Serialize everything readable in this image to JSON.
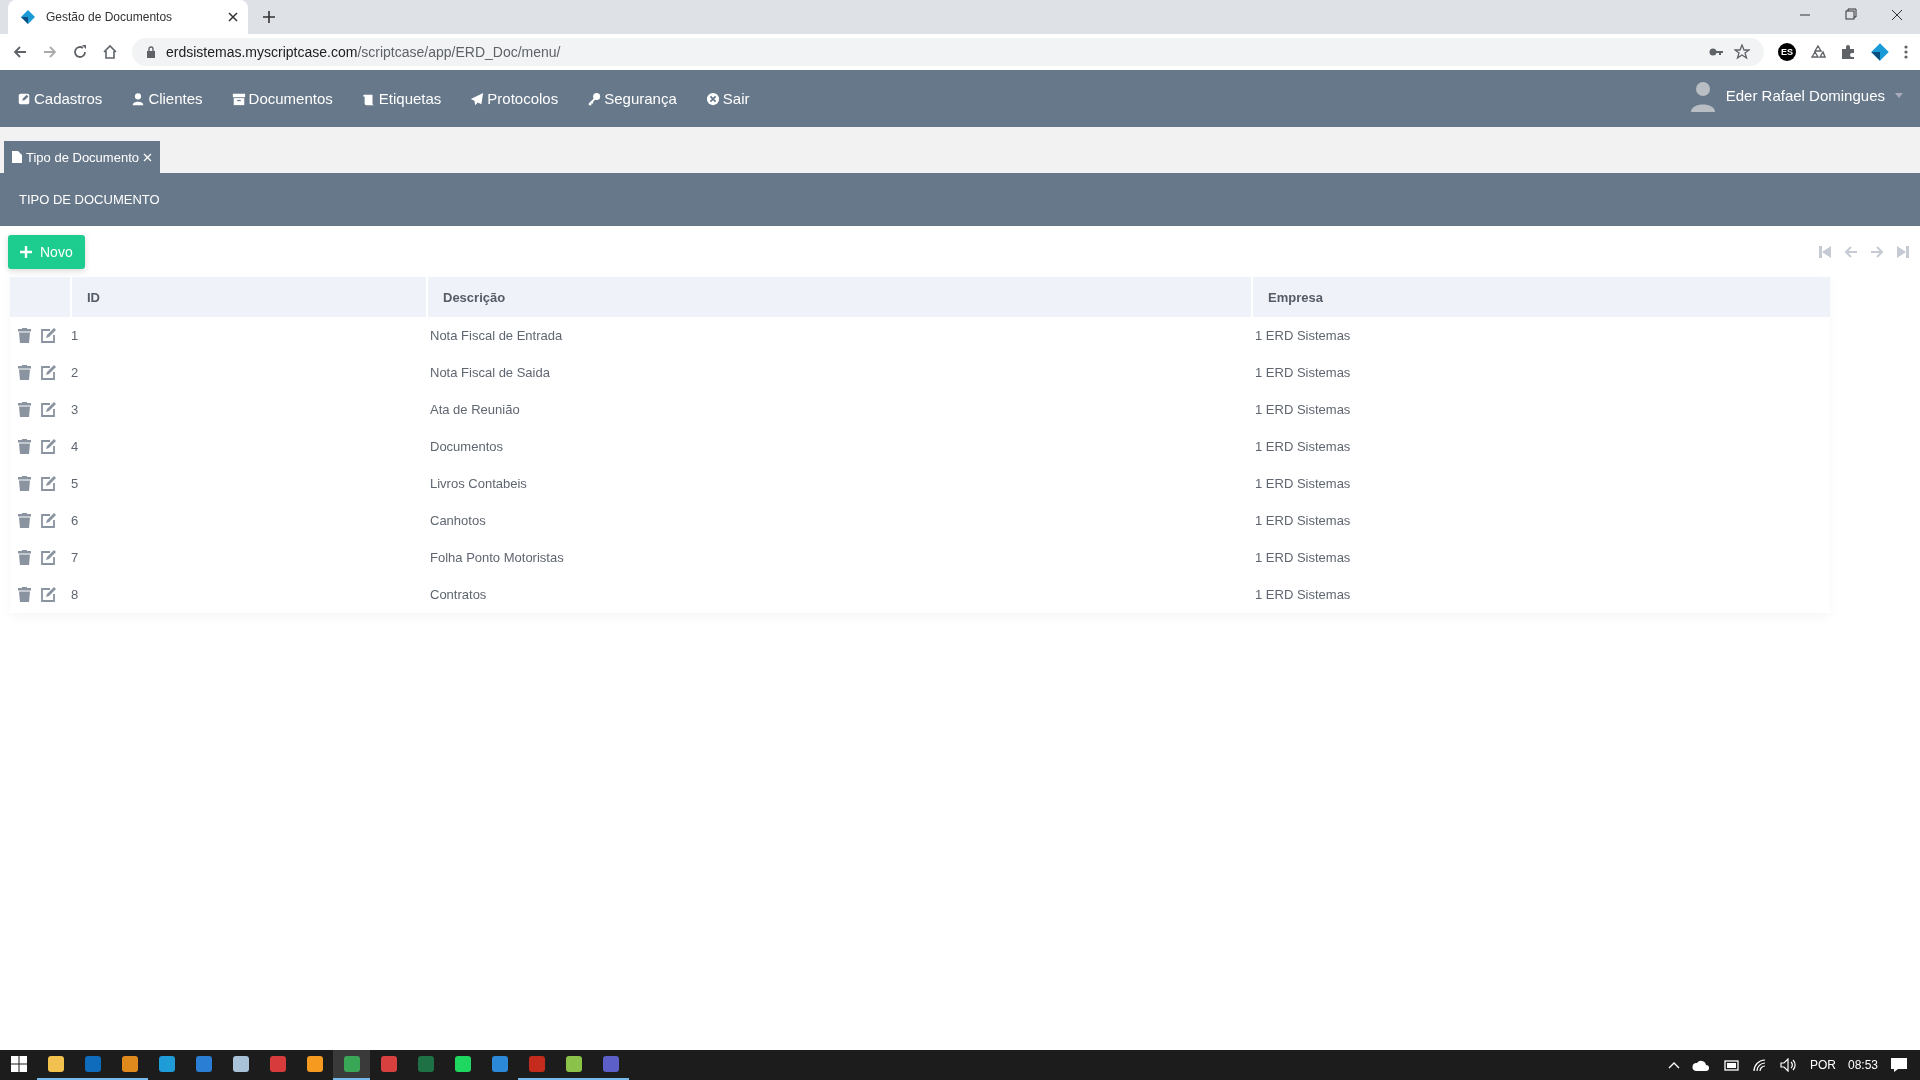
{
  "browser": {
    "tab_title": "Gestão de Documentos",
    "url_host": "erdsistemas.myscriptcase.com",
    "url_path": "/scriptcase/app/ERD_Doc/menu/",
    "extension_badge": "ES"
  },
  "nav": {
    "items": [
      {
        "label": "Cadastros",
        "kind": "edit"
      },
      {
        "label": "Clientes",
        "kind": "user"
      },
      {
        "label": "Documentos",
        "kind": "archive"
      },
      {
        "label": "Etiquetas",
        "kind": "scroll"
      },
      {
        "label": "Protocolos",
        "kind": "send"
      },
      {
        "label": "Segurança",
        "kind": "key"
      },
      {
        "label": "Sair",
        "kind": "close"
      }
    ],
    "user": "Eder Rafael Domingues"
  },
  "app_tabs": [
    {
      "label": "Tipo de Documento",
      "selected": true
    }
  ],
  "section_title": "TIPO DE DOCUMENTO",
  "new_button": "Novo",
  "table": {
    "columns": [
      "ID",
      "Descrição",
      "Empresa"
    ],
    "rows": [
      {
        "id": "1",
        "descricao": "Nota Fiscal de Entrada",
        "empresa": "1 ERD Sistemas"
      },
      {
        "id": "2",
        "descricao": "Nota Fiscal de Saida",
        "empresa": "1 ERD Sistemas"
      },
      {
        "id": "3",
        "descricao": "Ata de Reunião",
        "empresa": "1 ERD Sistemas"
      },
      {
        "id": "4",
        "descricao": "Documentos",
        "empresa": "1 ERD Sistemas"
      },
      {
        "id": "5",
        "descricao": "Livros Contabeis",
        "empresa": "1 ERD Sistemas"
      },
      {
        "id": "6",
        "descricao": "Canhotos",
        "empresa": "1 ERD Sistemas"
      },
      {
        "id": "7",
        "descricao": "Folha Ponto Motoristas",
        "empresa": "1 ERD Sistemas"
      },
      {
        "id": "8",
        "descricao": "Contratos",
        "empresa": "1 ERD Sistemas"
      }
    ]
  },
  "taskbar": {
    "apps": [
      {
        "kind": "folder",
        "running": true,
        "selected": false
      },
      {
        "kind": "outlook",
        "running": true,
        "selected": false
      },
      {
        "kind": "orange",
        "running": true,
        "selected": false
      },
      {
        "kind": "edge",
        "running": false,
        "selected": false
      },
      {
        "kind": "mail",
        "running": false,
        "selected": false
      },
      {
        "kind": "notepad",
        "running": false,
        "selected": false
      },
      {
        "kind": "red",
        "running": false,
        "selected": false
      },
      {
        "kind": "sublime",
        "running": false,
        "selected": false
      },
      {
        "kind": "chrome",
        "running": true,
        "selected": true
      },
      {
        "kind": "scissors",
        "running": false,
        "selected": false
      },
      {
        "kind": "excel",
        "running": false,
        "selected": false
      },
      {
        "kind": "spotify",
        "running": false,
        "selected": false
      },
      {
        "kind": "phone",
        "running": false,
        "selected": false
      },
      {
        "kind": "shield",
        "running": true,
        "selected": false
      },
      {
        "kind": "sheet",
        "running": true,
        "selected": false
      },
      {
        "kind": "teams",
        "running": true,
        "selected": false
      }
    ],
    "language": "POR",
    "time": "08:53"
  }
}
